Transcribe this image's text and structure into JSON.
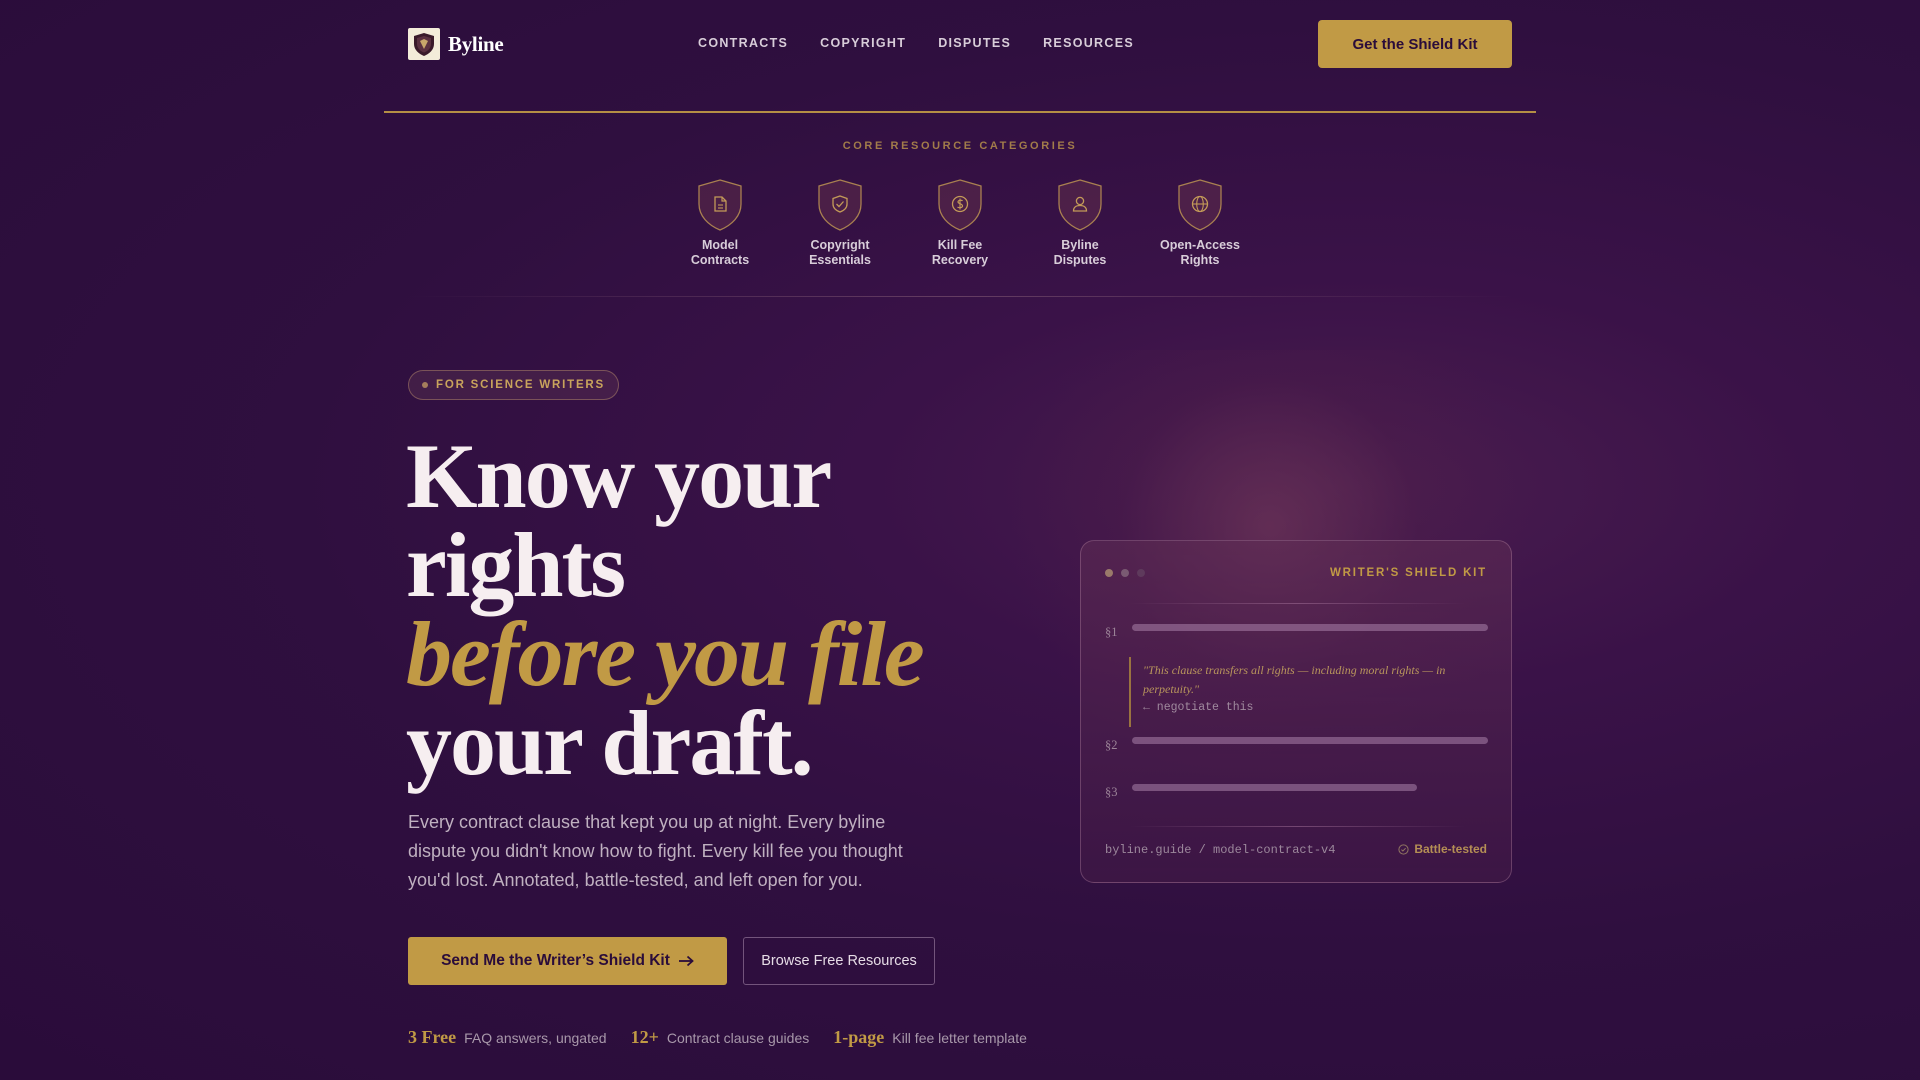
{
  "brand": {
    "name": "Byline"
  },
  "nav": [
    {
      "label": "CONTRACTS"
    },
    {
      "label": "COPYRIGHT"
    },
    {
      "label": "DISPUTES"
    },
    {
      "label": "RESOURCES"
    }
  ],
  "header_cta": "Get the Shield Kit",
  "categories": {
    "heading": "CORE RESOURCE CATEGORIES",
    "items": [
      {
        "line1": "Model",
        "line2": "Contracts",
        "icon": "document-icon"
      },
      {
        "line1": "Copyright",
        "line2": "Essentials",
        "icon": "shield-check-icon"
      },
      {
        "line1": "Kill Fee",
        "line2": "Recovery",
        "icon": "dollar-icon"
      },
      {
        "line1": "Byline",
        "line2": "Disputes",
        "icon": "person-icon"
      },
      {
        "line1": "Open-Access",
        "line2": "Rights",
        "icon": "globe-icon"
      }
    ]
  },
  "hero": {
    "badge": "FOR SCIENCE WRITERS",
    "headline_1": "Know your rights",
    "headline_accent": "before you file",
    "headline_2": "your draft.",
    "lede": "Every contract clause that kept you up at night. Every byline dispute you didn't know how to fight. Every kill fee you thought you'd lost. Annotated, battle-tested, and left open for you.",
    "primary_cta": "Send Me the Writer’s Shield Kit",
    "secondary_cta": "Browse Free Resources"
  },
  "stats": [
    {
      "value": "3 Free",
      "label": "FAQ answers, ungated"
    },
    {
      "value": "12+",
      "label": "Contract clause guides"
    },
    {
      "value": "1-page",
      "label": "Kill fee letter template"
    }
  ],
  "card": {
    "title": "WRITER'S SHIELD KIT",
    "sections": [
      "§1",
      "§2",
      "§3"
    ],
    "quote": "\"This clause transfers all rights — including moral rights — in perpetuity.\"",
    "note": "← negotiate this",
    "url": "byline.guide / model-contract-v4",
    "tag": "Battle-tested"
  },
  "colors": {
    "accent": "#c19a45",
    "background": "#2f0f3f",
    "text": "#f6eef0"
  }
}
